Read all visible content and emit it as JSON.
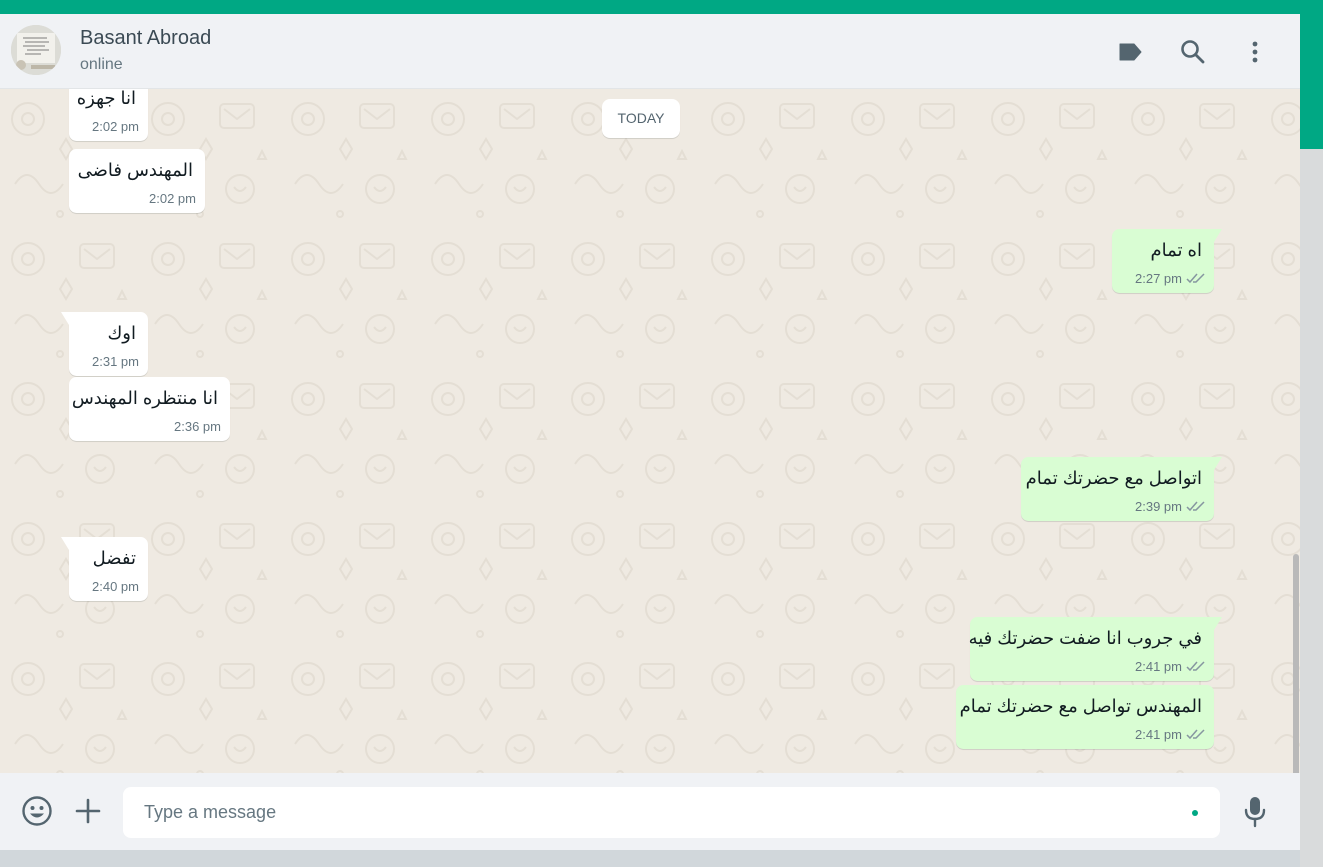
{
  "colors": {
    "accent": "#00a884",
    "incoming_bubble": "#ffffff",
    "outgoing_bubble": "#d9fdd3",
    "read_ticks": "#8696a0",
    "chat_background": "#efeae2"
  },
  "header": {
    "contact_name": "Basant Abroad",
    "status": "online",
    "icons": [
      "label-icon",
      "search-icon",
      "menu-icon"
    ]
  },
  "chat": {
    "date_divider": "TODAY",
    "messages": [
      {
        "direction": "in",
        "text": "انا جهزه",
        "time": "2:02 pm"
      },
      {
        "direction": "in",
        "text": "المهندس  فاضى",
        "time": "2:02 pm"
      },
      {
        "direction": "out",
        "text": "اه تمام",
        "time": "2:27 pm",
        "status": "read"
      },
      {
        "direction": "in",
        "text": "اوك",
        "time": "2:31 pm"
      },
      {
        "direction": "in",
        "text": "انا منتظره المهندس",
        "time": "2:36 pm"
      },
      {
        "direction": "out",
        "text": "اتواصل مع حضرتك تمام",
        "time": "2:39 pm",
        "status": "read"
      },
      {
        "direction": "in",
        "text": "تفضل",
        "time": "2:40 pm"
      },
      {
        "direction": "out",
        "text": "في جروب انا ضفت حضرتك فيه",
        "time": "2:41 pm",
        "status": "read"
      },
      {
        "direction": "out",
        "text": "المهندس تواصل مع حضرتك تمام",
        "time": "2:41 pm",
        "status": "read"
      }
    ]
  },
  "composer": {
    "placeholder": "Type a message",
    "value": "",
    "icons": [
      "emoji-icon",
      "attach-plus-icon",
      "microphone-icon"
    ]
  }
}
